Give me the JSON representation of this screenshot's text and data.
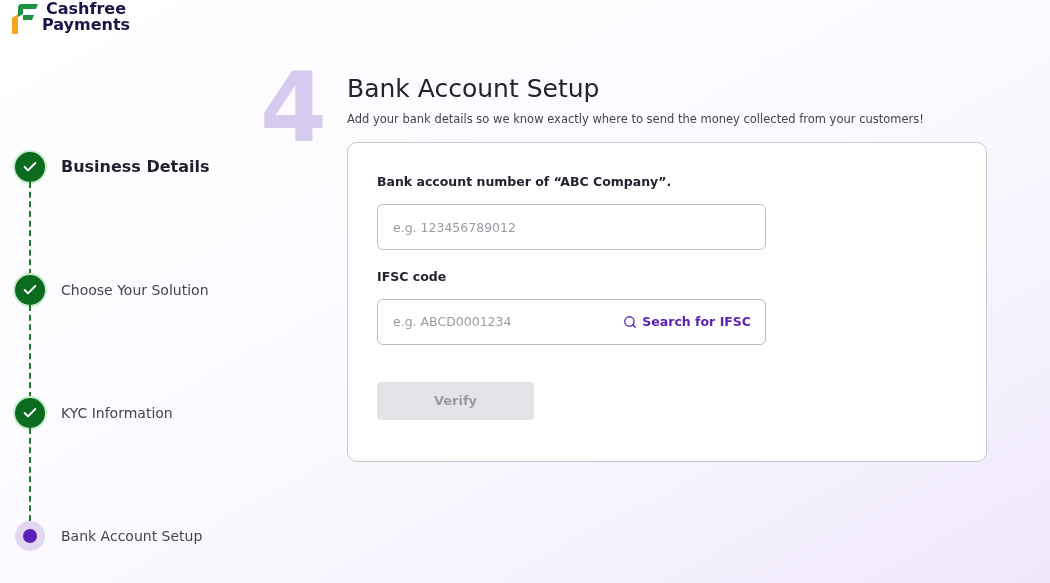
{
  "logo": {
    "lines": [
      "Cashfree",
      "Payments"
    ]
  },
  "steps": [
    {
      "label": "Business Details",
      "kind": "done",
      "highlighted": true
    },
    {
      "label": "Choose Your Solution",
      "kind": "done",
      "highlighted": false
    },
    {
      "label": "KYC Information",
      "kind": "done",
      "highlighted": false
    },
    {
      "label": "Bank Account Setup",
      "kind": "current",
      "highlighted": false
    }
  ],
  "step_number": "4",
  "title": "Bank Account Setup",
  "subtitle": "Add your bank details so we know exactly where to send the money collected from your customers!",
  "form": {
    "fields": [
      {
        "label": "Bank account number of “ABC Company”.",
        "placeholder": "e.g. 123456789012"
      },
      {
        "label": "IFSC code",
        "placeholder": "e.g. ABCD0001234",
        "action": "Search for IFSC"
      }
    ],
    "button": {
      "label": "Verify",
      "disabled": true
    }
  }
}
